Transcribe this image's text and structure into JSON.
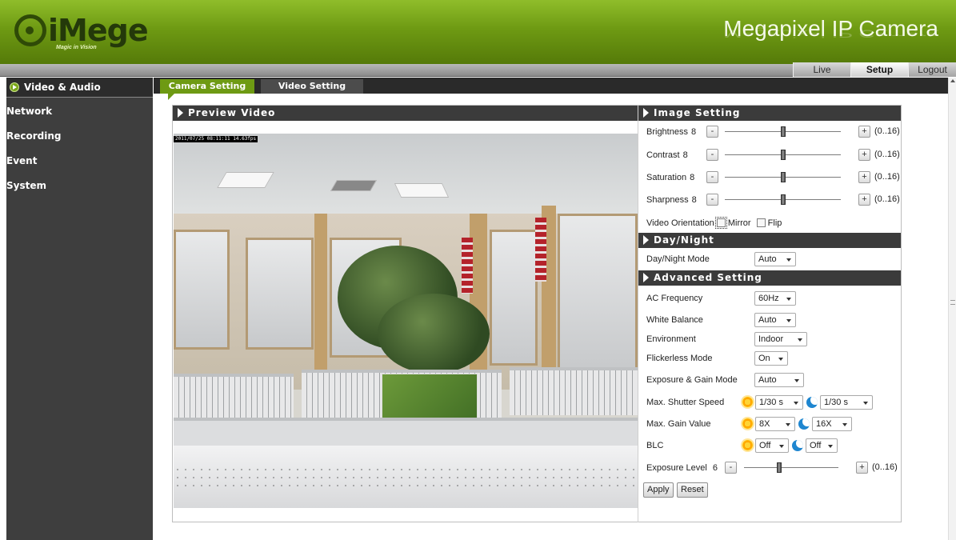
{
  "header": {
    "logo_text": "iMege",
    "logo_tagline": "Magic in Vision",
    "product_title": "Megapixel IP Camera"
  },
  "topnav": {
    "live": "Live",
    "setup": "Setup",
    "logout": "Logout"
  },
  "sidebar": {
    "items": [
      {
        "label": "Video & Audio"
      },
      {
        "label": "Network"
      },
      {
        "label": "Recording"
      },
      {
        "label": "Event"
      },
      {
        "label": "System"
      }
    ]
  },
  "tabs": {
    "camera_setting": "Camera Setting",
    "video_setting": "Video Setting"
  },
  "preview": {
    "title": "Preview Video",
    "timestamp": "2011/07/25 08:11:11 14.63fps"
  },
  "image_setting": {
    "title": "Image Setting",
    "range": "(0..16)",
    "minus": "-",
    "plus": "+",
    "sliders": [
      {
        "label": "Brightness",
        "value": "8",
        "level": 0.5
      },
      {
        "label": "Contrast",
        "value": "8",
        "level": 0.5
      },
      {
        "label": "Saturation",
        "value": "8",
        "level": 0.5
      },
      {
        "label": "Sharpness",
        "value": "8",
        "level": 0.5
      }
    ],
    "orientation_label": "Video Orientation",
    "mirror_label": "Mirror",
    "flip_label": "Flip"
  },
  "day_night": {
    "title": "Day/Night",
    "mode_label": "Day/Night Mode",
    "mode_value": "Auto"
  },
  "advanced": {
    "title": "Advanced Setting",
    "ac_frequency_label": "AC Frequency",
    "ac_frequency_value": "60Hz",
    "white_balance_label": "White Balance",
    "white_balance_value": "Auto",
    "environment_label": "Environment",
    "environment_value": "Indoor",
    "flickerless_label": "Flickerless Mode",
    "flickerless_value": "On",
    "exposure_gain_label": "Exposure & Gain Mode",
    "exposure_gain_value": "Auto",
    "shutter_label": "Max. Shutter Speed",
    "shutter_day": "1/30 s",
    "shutter_night": "1/30 s",
    "gain_label": "Max. Gain Value",
    "gain_day": "8X",
    "gain_night": "16X",
    "blc_label": "BLC",
    "blc_day": "Off",
    "blc_night": "Off",
    "exposure_level_label": "Exposure Level",
    "exposure_level_value": "6",
    "exposure_level_level": 0.375,
    "range": "(0..16)"
  },
  "actions": {
    "apply": "Apply",
    "reset": "Reset"
  },
  "icons": [
    "sun-icon",
    "moon-icon",
    "arrow-right-icon"
  ],
  "colors": {
    "brand_green": "#6e9a13",
    "header_dark": "#3b3b3b",
    "sidebar_bg": "#3e3e3e"
  }
}
